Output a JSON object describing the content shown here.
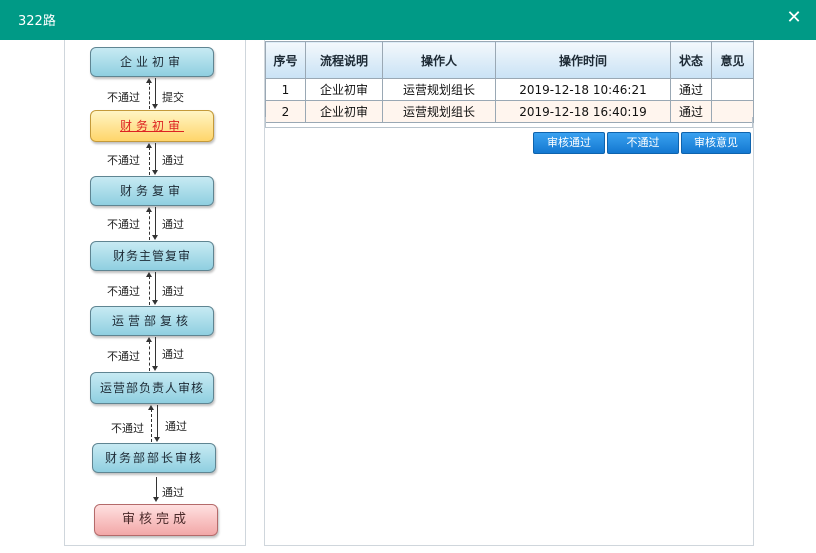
{
  "window": {
    "title": "322路",
    "close_icon": "close-icon"
  },
  "flow": {
    "nodes": [
      {
        "id": "n1",
        "label": "企业初审"
      },
      {
        "id": "n2",
        "label": "财务初审"
      },
      {
        "id": "n3",
        "label": "财务复审"
      },
      {
        "id": "n4",
        "label": "财务主管复审"
      },
      {
        "id": "n5",
        "label": "运营部复核"
      },
      {
        "id": "n6",
        "label": "运营部负责人审核"
      },
      {
        "id": "n7",
        "label": "财务部部长审核"
      },
      {
        "id": "n8",
        "label": "审核完成"
      }
    ],
    "current_node": "财务初审",
    "edges": [
      {
        "back": "不通过",
        "forward": "提交"
      },
      {
        "back": "不通过",
        "forward": "通过"
      },
      {
        "back": "不通过",
        "forward": "通过"
      },
      {
        "back": "不通过",
        "forward": "通过"
      },
      {
        "back": "不通过",
        "forward": "通过"
      },
      {
        "back": "不通过",
        "forward": "通过"
      },
      {
        "back": "",
        "forward": "通过"
      }
    ]
  },
  "table": {
    "columns": [
      "序号",
      "流程说明",
      "操作人",
      "操作时间",
      "状态",
      "意见"
    ],
    "rows": [
      [
        "1",
        "企业初审",
        "运营规划组长",
        "2019-12-18 10:46:21",
        "通过",
        ""
      ],
      [
        "2",
        "企业初审",
        "运营规划组长",
        "2019-12-18 16:40:19",
        "通过",
        ""
      ]
    ]
  },
  "actions": {
    "approve": "审核通过",
    "reject": "不通过",
    "opinion": "审核意见"
  },
  "colors": {
    "titlebar": "#009a86",
    "button": "#1e88e5",
    "current_node": "#ffd56a"
  }
}
